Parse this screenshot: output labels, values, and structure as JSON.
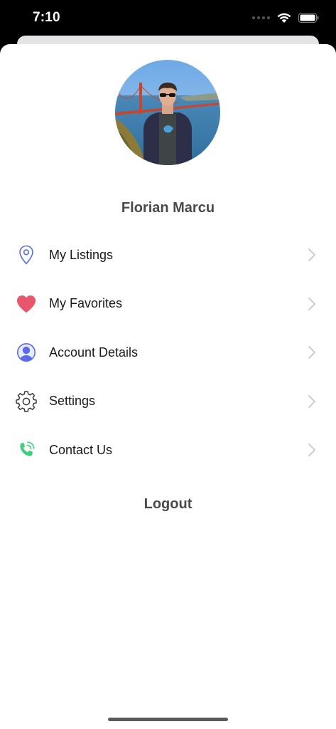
{
  "status_bar": {
    "time": "7:10"
  },
  "profile": {
    "name": "Florian Marcu"
  },
  "menu": {
    "items": [
      {
        "label": "My Listings",
        "icon": "location-pin-icon",
        "icon_color": "#5b6bea"
      },
      {
        "label": "My Favorites",
        "icon": "heart-icon",
        "icon_color": "#e8566c"
      },
      {
        "label": "Account Details",
        "icon": "user-circle-icon",
        "icon_color": "#5b6bea"
      },
      {
        "label": "Settings",
        "icon": "gear-icon",
        "icon_color": "#3a3a3a"
      },
      {
        "label": "Contact Us",
        "icon": "phone-icon",
        "icon_color": "#3ecf7a"
      }
    ]
  },
  "logout_label": "Logout",
  "colors": {
    "accent": "#5b6bea",
    "favorite": "#e8566c",
    "contact": "#3ecf7a",
    "heading_text": "#4a4a4a",
    "chevron": "#c7c7cc"
  }
}
